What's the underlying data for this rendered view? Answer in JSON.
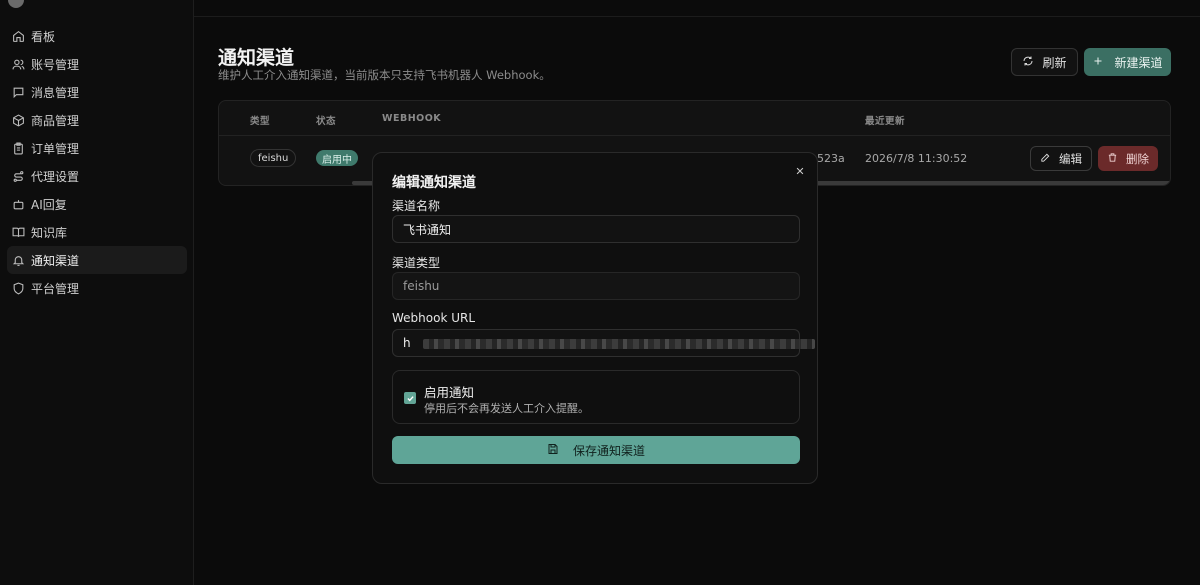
{
  "app": {
    "name": ""
  },
  "sidebar": {
    "items": [
      {
        "label": "看板",
        "icon": "home-icon"
      },
      {
        "label": "账号管理",
        "icon": "users-icon"
      },
      {
        "label": "消息管理",
        "icon": "message-icon"
      },
      {
        "label": "商品管理",
        "icon": "box-icon"
      },
      {
        "label": "订单管理",
        "icon": "clipboard-icon"
      },
      {
        "label": "代理设置",
        "icon": "route-icon"
      },
      {
        "label": "AI回复",
        "icon": "bot-icon"
      },
      {
        "label": "知识库",
        "icon": "book-icon"
      },
      {
        "label": "通知渠道",
        "icon": "bell-icon",
        "active": true
      },
      {
        "label": "平台管理",
        "icon": "shield-icon"
      }
    ]
  },
  "header": {
    "title": "通知渠道",
    "subtitle": "维护人工介入通知渠道，当前版本只支持飞书机器人 Webhook。",
    "refresh_label": "刷新",
    "new_label": "新建渠道"
  },
  "table": {
    "columns": [
      "类型",
      "状态",
      "WEBHOOK",
      "最近更新"
    ],
    "rows": [
      {
        "type": "feishu",
        "status": "启用中",
        "webhook_tail": "523a",
        "updated": "2026/7/8 11:30:52",
        "edit_label": "编辑",
        "delete_label": "删除"
      }
    ]
  },
  "modal": {
    "title": "编辑通知渠道",
    "name_label": "渠道名称",
    "name_value": "飞书通知",
    "type_label": "渠道类型",
    "type_value": "feishu",
    "url_label": "Webhook URL",
    "url_prefix": "h",
    "enable_title": "启用通知",
    "enable_desc": "停用后不会再发送人工介入提醒。",
    "enable_checked": true,
    "save_label": "保存通知渠道"
  },
  "colors": {
    "accent": "#5fa597",
    "accent_dark": "#3b6f63",
    "danger": "#6b2a2a",
    "background": "#0b0b0b"
  }
}
